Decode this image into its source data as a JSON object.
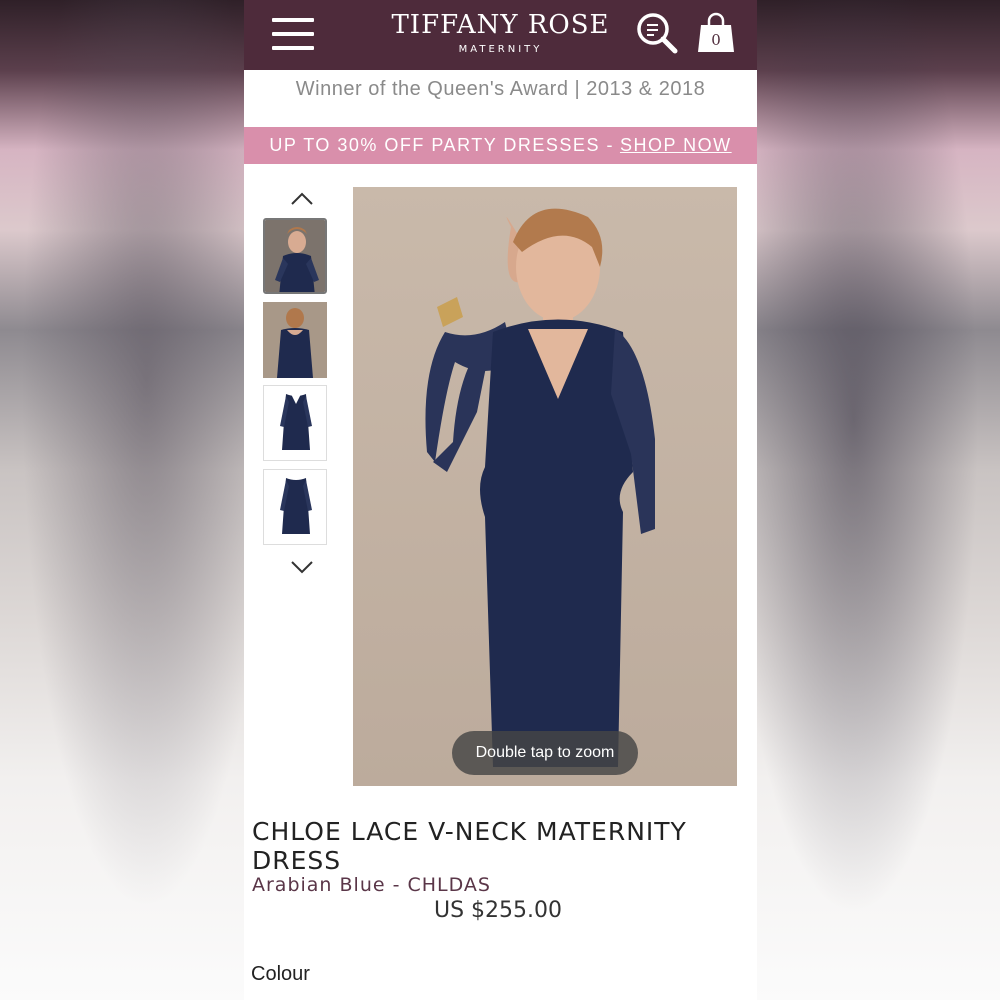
{
  "header": {
    "menu_icon": "hamburger-menu-icon",
    "brand_name": "TIFFANY ROSE",
    "brand_sub": "MATERNITY",
    "search_icon": "search-icon",
    "bag_icon": "shopping-bag-icon",
    "bag_count": "0",
    "color": "#4e2b3b"
  },
  "award_text": "Winner of the Queen's Award | 2013 & 2018",
  "promo": {
    "text": "UP TO 30% OFF PARTY DRESSES -",
    "link": "SHOP NOW",
    "color": "#d98fab"
  },
  "gallery": {
    "up_icon": "chevron-up-icon",
    "down_icon": "chevron-down-icon",
    "thumb_count": 4,
    "active_thumb": 1,
    "zoom_hint": "Double tap to zoom"
  },
  "product": {
    "title": "CHLOE LACE V-NECK MATERNITY DRESS",
    "colour_code": "Arabian Blue - CHLDAS",
    "price": "US $255.00",
    "colour_label": "Colour",
    "dress_color": "#1f2a4e"
  }
}
